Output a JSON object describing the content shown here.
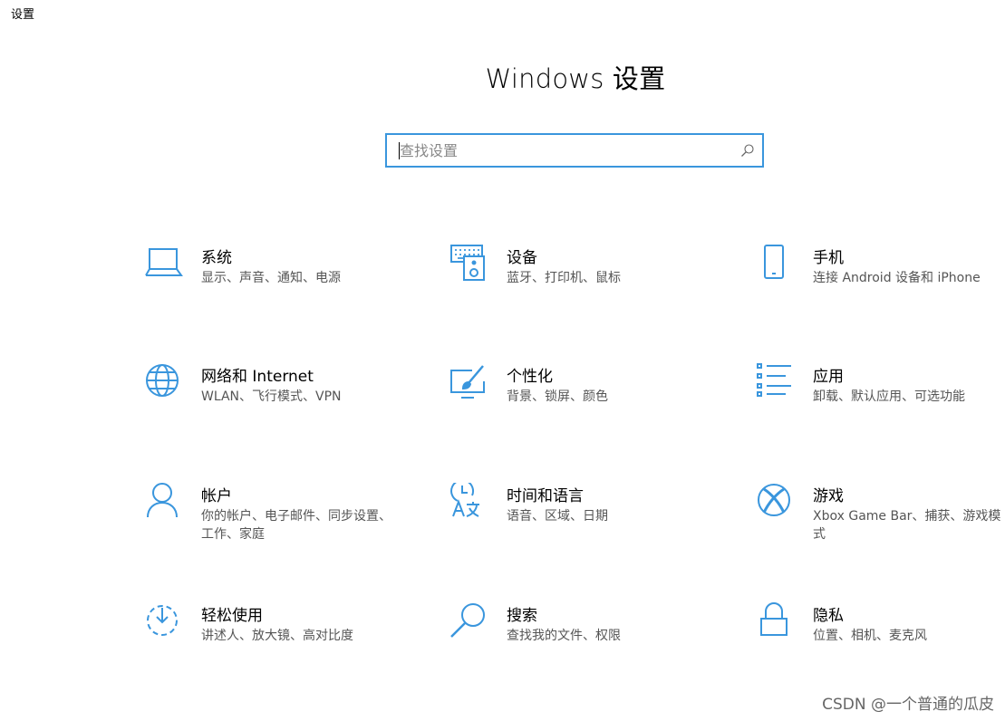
{
  "window": {
    "title": "设置"
  },
  "header": {
    "title": "Windows 设置"
  },
  "search": {
    "placeholder": "查找设置",
    "value": ""
  },
  "colors": {
    "accent": "#3a96dd",
    "desc_text": "#555555"
  },
  "tiles": [
    {
      "name": "系统",
      "desc": "显示、声音、通知、电源",
      "icon": "laptop-icon"
    },
    {
      "name": "设备",
      "desc": "蓝牙、打印机、鼠标",
      "icon": "devices-icon"
    },
    {
      "name": "手机",
      "desc": "连接 Android 设备和 iPhone",
      "icon": "phone-icon"
    },
    {
      "name": "网络和 Internet",
      "desc": "WLAN、飞行模式、VPN",
      "icon": "globe-icon"
    },
    {
      "name": "个性化",
      "desc": "背景、锁屏、颜色",
      "icon": "personalization-icon"
    },
    {
      "name": "应用",
      "desc": "卸载、默认应用、可选功能",
      "icon": "apps-list-icon"
    },
    {
      "name": "帐户",
      "desc": "你的帐户、电子邮件、同步设置、工作、家庭",
      "icon": "person-icon"
    },
    {
      "name": "时间和语言",
      "desc": "语音、区域、日期",
      "icon": "time-language-icon"
    },
    {
      "name": "游戏",
      "desc": "Xbox Game Bar、捕获、游戏模式",
      "icon": "xbox-icon"
    },
    {
      "name": "轻松使用",
      "desc": "讲述人、放大镜、高对比度",
      "icon": "ease-of-access-icon"
    },
    {
      "name": "搜索",
      "desc": "查找我的文件、权限",
      "icon": "search-icon"
    },
    {
      "name": "隐私",
      "desc": "位置、相机、麦克风",
      "icon": "lock-icon"
    }
  ],
  "watermark": {
    "text": "CSDN @一个普通的瓜皮"
  }
}
